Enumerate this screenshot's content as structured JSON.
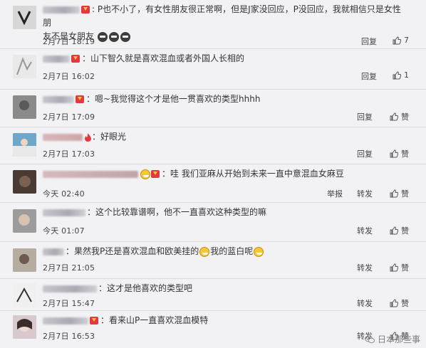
{
  "comments": [
    {
      "text": ": P也不小了，有女性朋友很正常啊，但是J家没回应，P没回应，我就相信只是女性朋",
      "text2": "友不是女朋友",
      "time": "2月7日 18:19",
      "reply": "回复",
      "likes": "7"
    },
    {
      "text": "：山下智久就是喜欢混血或者外国人长相的",
      "time": "2月7日 16:02",
      "reply": "回复",
      "likes": "1"
    },
    {
      "text": "：嗯~我觉得这个才是他一贯喜欢的类型hhhh",
      "time": "2月7日 17:09",
      "reply": "回复",
      "likes": "赞"
    },
    {
      "text": "：好眼光",
      "time": "2月7日 17:03",
      "reply": "回复",
      "likes": "赞"
    },
    {
      "text": "：哇 我们亚麻从开始到未来一直中意混血女麻豆",
      "time": "今天 02:40",
      "report": "举报",
      "forward": "转发",
      "likes": "赞"
    },
    {
      "text": "：这个比较靠谱啊，他不一直喜欢这种类型的嘛",
      "time": "今天 01:07",
      "forward": "转发",
      "likes": "赞"
    },
    {
      "text": "：果然我P还是喜欢混血和欧美挂的",
      "text2": "我的蓝白呢",
      "time": "2月7日 21:05",
      "forward": "转发",
      "likes": "赞"
    },
    {
      "text": "：这才是他喜欢的类型吧",
      "time": "2月7日 15:47",
      "forward": "转发",
      "likes": "赞"
    },
    {
      "text": "：看来山P一直喜欢混血模特",
      "time": "2月7日 16:53",
      "forward": "转发",
      "likes": "赞"
    }
  ],
  "watermark": "日本那些事"
}
